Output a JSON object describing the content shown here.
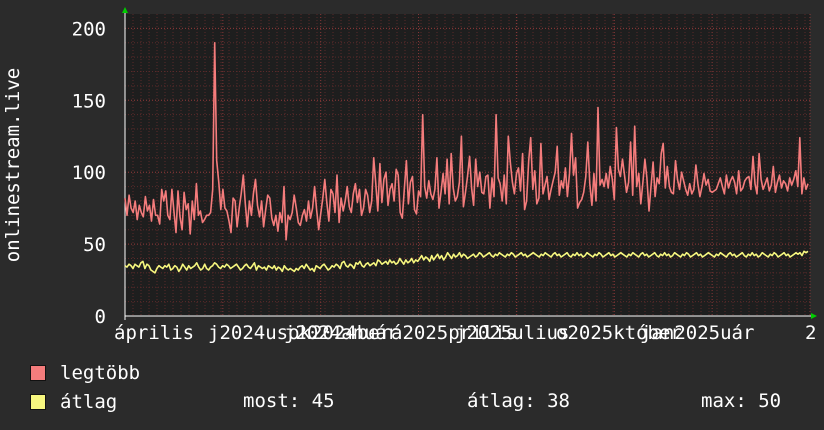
{
  "chart_data": {
    "type": "line",
    "ylabel": "onlinestream.live",
    "ylim": [
      0,
      210
    ],
    "yticks": [
      0,
      50,
      100,
      150,
      200
    ],
    "x_tick_labels": [
      "április",
      "július",
      "október",
      "január",
      "április",
      "július",
      "október",
      "január"
    ],
    "x_tick_years": [
      "",
      "2024",
      "2024",
      "2024",
      "2025",
      "2025",
      "2025",
      "2025"
    ],
    "x_tick_displays": [
      "április",
      "j2024usok2024ber",
      "j2024anuár",
      "á2025prilis",
      "j2025ulius",
      "o2025któber",
      "jan2025uár",
      "2"
    ],
    "grid": true,
    "series": [
      {
        "name": "legtöbb",
        "color": "#f47c7c",
        "values": [
          82,
          70,
          84,
          75,
          72,
          80,
          67,
          77,
          72,
          69,
          83,
          73,
          77,
          66,
          81,
          70,
          70,
          64,
          88,
          80,
          87,
          70,
          67,
          88,
          73,
          58,
          87,
          69,
          60,
          86,
          74,
          78,
          57,
          80,
          67,
          92,
          70,
          73,
          65,
          67,
          70,
          70,
          72,
          88,
          190,
          108,
          93,
          74,
          88,
          75,
          73,
          66,
          58,
          82,
          80,
          62,
          75,
          85,
          98,
          78,
          62,
          80,
          70,
          85,
          95,
          77,
          69,
          80,
          62,
          74,
          84,
          82,
          68,
          63,
          70,
          59,
          72,
          65,
          90,
          53,
          70,
          67,
          72,
          84,
          75,
          65,
          63,
          70,
          74,
          66,
          80,
          68,
          75,
          90,
          74,
          60,
          71,
          82,
          95,
          79,
          66,
          88,
          85,
          72,
          98,
          65,
          82,
          73,
          80,
          90,
          76,
          72,
          85,
          92,
          79,
          88,
          70,
          75,
          88,
          84,
          72,
          80,
          110,
          92,
          73,
          106,
          79,
          95,
          100,
          77,
          88,
          92,
          80,
          102,
          98,
          72,
          68,
          88,
          108,
          78,
          93,
          97,
          74,
          71,
          87,
          83,
          140,
          90,
          82,
          94,
          85,
          81,
          88,
          110,
          75,
          86,
          99,
          85,
          109,
          78,
          113,
          89,
          80,
          83,
          93,
          125,
          76,
          86,
          97,
          111,
          89,
          77,
          109,
          90,
          100,
          86,
          85,
          97,
          98,
          75,
          96,
          83,
          140,
          96,
          92,
          80,
          98,
          78,
          125,
          107,
          93,
          85,
          99,
          103,
          87,
          113,
          74,
          80,
          108,
          124,
          88,
          101,
          78,
          82,
          120,
          85,
          91,
          97,
          81,
          88,
          94,
          100,
          118,
          84,
          94,
          89,
          103,
          83,
          99,
          127,
          98,
          110,
          75,
          79,
          81,
          86,
          97,
          121,
          92,
          77,
          99,
          80,
          145,
          91,
          95,
          90,
          99,
          89,
          104,
          95,
          81,
          131,
          102,
          97,
          109,
          98,
          86,
          93,
          121,
          84,
          132,
          90,
          99,
          78,
          93,
          109,
          96,
          73,
          90,
          107,
          83,
          96,
          92,
          113,
          120,
          89,
          104,
          90,
          86,
          85,
          108,
          95,
          88,
          100,
          94,
          88,
          84,
          92,
          85,
          88,
          105,
          92,
          83,
          90,
          99,
          91,
          95,
          87,
          86,
          87,
          88,
          92,
          96,
          90,
          85,
          98,
          89,
          94,
          97,
          93,
          85,
          101,
          87,
          89,
          94,
          96,
          97,
          88,
          111,
          92,
          85,
          113,
          95,
          88,
          92,
          96,
          87,
          91,
          104,
          86,
          93,
          98,
          89,
          94,
          92,
          87,
          96,
          91,
          95,
          101,
          90,
          124,
          85,
          96,
          88,
          92
        ]
      },
      {
        "name": "átlag",
        "color": "#f7f77f",
        "values": [
          35,
          34,
          36,
          35,
          33,
          36,
          35,
          34,
          37,
          38,
          33,
          36,
          35,
          32,
          31,
          30,
          33,
          35,
          34,
          33,
          35,
          34,
          36,
          32,
          33,
          35,
          34,
          31,
          33,
          36,
          34,
          32,
          35,
          33,
          34,
          35,
          37,
          34,
          32,
          33,
          36,
          33,
          32,
          34,
          35,
          37,
          36,
          34,
          33,
          35,
          34,
          36,
          35,
          33,
          34,
          35,
          36,
          34,
          32,
          33,
          35,
          36,
          34,
          33,
          35,
          37,
          32,
          35,
          34,
          33,
          34,
          32,
          35,
          34,
          33,
          35,
          32,
          34,
          33,
          31,
          35,
          33,
          32,
          33,
          32,
          31,
          33,
          32,
          34,
          35,
          33,
          36,
          34,
          32,
          33,
          31,
          35,
          34,
          33,
          35,
          36,
          34,
          32,
          33,
          35,
          34,
          36,
          35,
          33,
          37,
          38,
          35,
          34,
          36,
          35,
          33,
          37,
          36,
          38,
          35,
          34,
          36,
          37,
          35,
          36,
          37,
          35,
          39,
          38,
          36,
          37,
          38,
          36,
          39,
          37,
          38,
          36,
          37,
          40,
          38,
          36,
          39,
          37,
          38,
          40,
          37,
          39,
          38,
          40,
          42,
          39,
          41,
          40,
          38,
          42,
          39,
          41,
          43,
          40,
          42,
          39,
          41,
          44,
          42,
          40,
          43,
          41,
          42,
          44,
          41,
          43,
          42,
          40,
          41,
          42,
          43,
          41,
          42,
          44,
          43,
          41,
          42,
          43,
          44,
          42,
          41,
          43,
          42,
          44,
          43,
          42,
          41,
          43,
          42,
          44,
          43,
          41,
          42,
          43,
          44,
          42,
          43,
          41,
          42,
          43,
          44,
          43,
          42,
          41,
          43,
          42,
          44,
          43,
          42,
          41,
          43,
          44,
          42,
          43,
          41,
          42,
          43,
          44,
          42,
          41,
          43,
          42,
          44,
          42,
          43,
          41,
          42,
          44,
          43,
          42,
          41,
          43,
          42,
          44,
          43,
          41,
          42,
          43,
          44,
          42,
          43,
          41,
          42,
          43,
          44,
          43,
          42,
          41,
          43,
          42,
          44,
          43,
          42,
          41,
          43,
          44,
          42,
          43,
          41,
          42,
          43,
          44,
          42,
          41,
          43,
          42,
          44,
          42,
          43,
          41,
          42,
          44,
          43,
          42,
          41,
          43,
          42,
          44,
          43,
          41,
          42,
          43,
          44,
          42,
          43,
          41,
          42,
          43,
          44,
          43,
          42,
          41,
          43,
          42,
          44,
          43,
          42,
          41,
          43,
          44,
          42,
          43,
          41,
          42,
          43,
          44,
          42,
          41,
          43,
          42,
          44,
          42,
          43,
          41,
          42,
          44,
          43,
          42,
          41,
          43,
          42,
          44,
          43,
          41,
          42,
          43,
          44,
          42,
          43,
          41,
          42,
          43,
          44,
          43,
          44,
          42,
          45,
          44,
          45
        ]
      }
    ]
  },
  "legend": {
    "max_label": "legtöbb",
    "avg_label": "átlag",
    "now_text": "most: 45",
    "avg_text": "átlag: 38",
    "max_text": "max: 50"
  },
  "colors": {
    "background": "#2b2b2b",
    "plot_background": "#1e1e1e",
    "grid_minor": "#5a2a2a",
    "axis_marker": "#00cc00"
  }
}
